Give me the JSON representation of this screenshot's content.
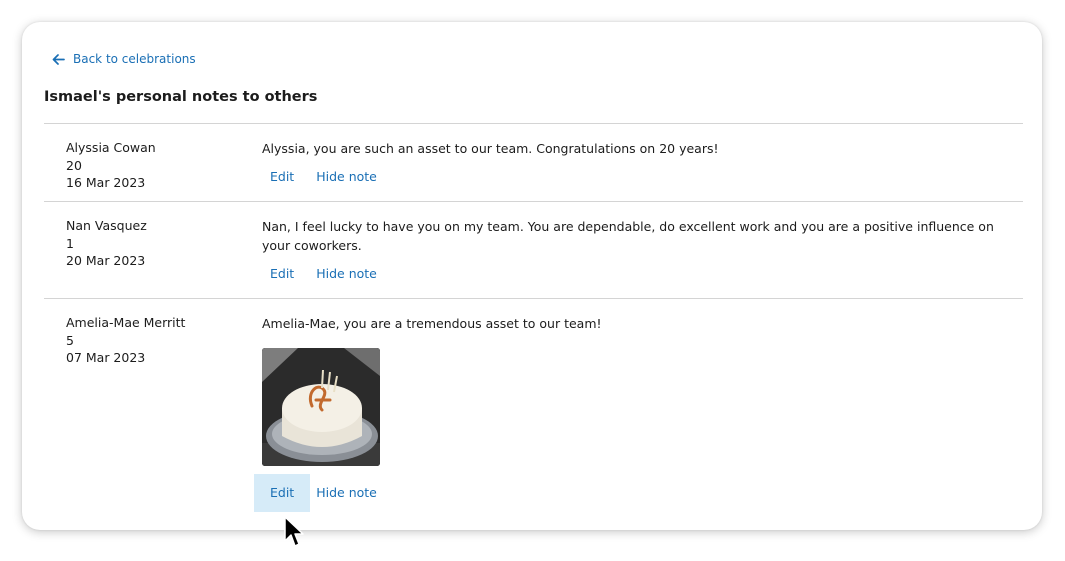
{
  "nav": {
    "back_label": "Back to celebrations"
  },
  "page": {
    "title": "Ismael's personal notes to others"
  },
  "notes": [
    {
      "name": "Alyssia Cowan",
      "years": "20",
      "date": "16 Mar 2023",
      "message": "Alyssia, you are such an asset to our team. Congratulations on 20 years!",
      "edit_label": "Edit",
      "hide_label": "Hide note"
    },
    {
      "name": "Nan Vasquez",
      "years": "1",
      "date": "20 Mar 2023",
      "message": "Nan, I feel lucky to have you on my team. You are dependable, do excellent work and you are a positive influence on your coworkers.",
      "edit_label": "Edit",
      "hide_label": "Hide note"
    },
    {
      "name": "Amelia-Mae Merritt",
      "years": "5",
      "date": "07 Mar 2023",
      "message": "Amelia-Mae, you are a tremendous asset to our team!",
      "edit_label": "Edit",
      "hide_label": "Hide note",
      "image": "cake-photo"
    }
  ],
  "colors": {
    "link": "#1a6fb5",
    "hover_bg": "#d6ebf8",
    "divider": "#d4d4d4",
    "text": "#1c1c1c"
  },
  "icons": {
    "back": "arrow-left-icon",
    "cursor": "mouse-pointer"
  }
}
